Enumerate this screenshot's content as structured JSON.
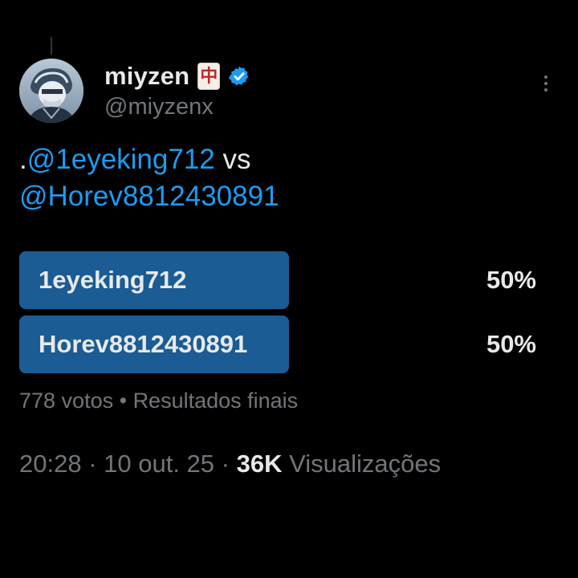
{
  "author": {
    "display_name": "miyzen",
    "emoji_tile": "中",
    "handle": "@miyzenx",
    "verified": true,
    "verified_color": "#1d9bf0"
  },
  "tweet": {
    "prefix": ".",
    "mention_1": "@1eyeking712",
    "connector": " vs",
    "mention_2": "@Horev8812430891"
  },
  "poll": {
    "options": [
      {
        "label": "1eyeking712",
        "percent_text": "50%",
        "percent": 50
      },
      {
        "label": "Horev8812430891",
        "percent_text": "50%",
        "percent": 50
      }
    ],
    "votes": "778 votos",
    "separator": " • ",
    "status": "Resultados finais",
    "bar_color": "#1a5c93"
  },
  "meta": {
    "time": "20:28",
    "dot": " · ",
    "date": "10 out. 25",
    "views_count": "36K",
    "views_label": " Visualizações"
  },
  "icons": {
    "more": "more-vertical-icon",
    "verified": "verified-badge-icon",
    "emoji": "mahjong-red-dragon-icon"
  }
}
